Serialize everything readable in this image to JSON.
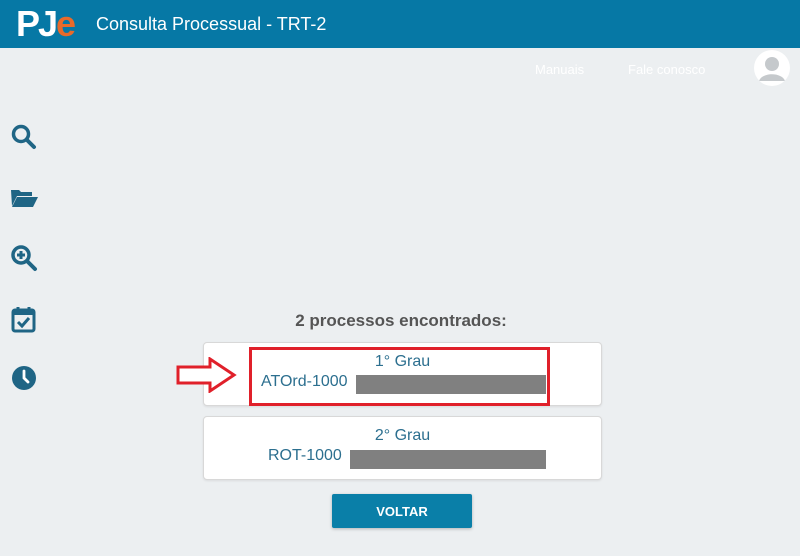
{
  "header": {
    "logo_pj": "PJ",
    "logo_e": "e",
    "title": "Consulta Processual - TRT-2"
  },
  "subnav": {
    "manuais": "Manuais",
    "fale_conosco": "Fale conosco"
  },
  "sidebar": {
    "icons": [
      "search-icon",
      "folder-open-icon",
      "zoom-in-icon",
      "calendar-check-icon",
      "clock-icon"
    ]
  },
  "results": {
    "title": "2 processos encontrados:",
    "items": [
      {
        "grau": "1° Grau",
        "numero": "ATOrd-1000"
      },
      {
        "grau": "2° Grau",
        "numero": "ROT-1000"
      }
    ]
  },
  "actions": {
    "voltar": "VOLTAR"
  },
  "colors": {
    "header_bg": "#0678a5",
    "link_text": "#2c6f8f",
    "highlight": "#e0202a",
    "logo_accent": "#e86a2a"
  }
}
